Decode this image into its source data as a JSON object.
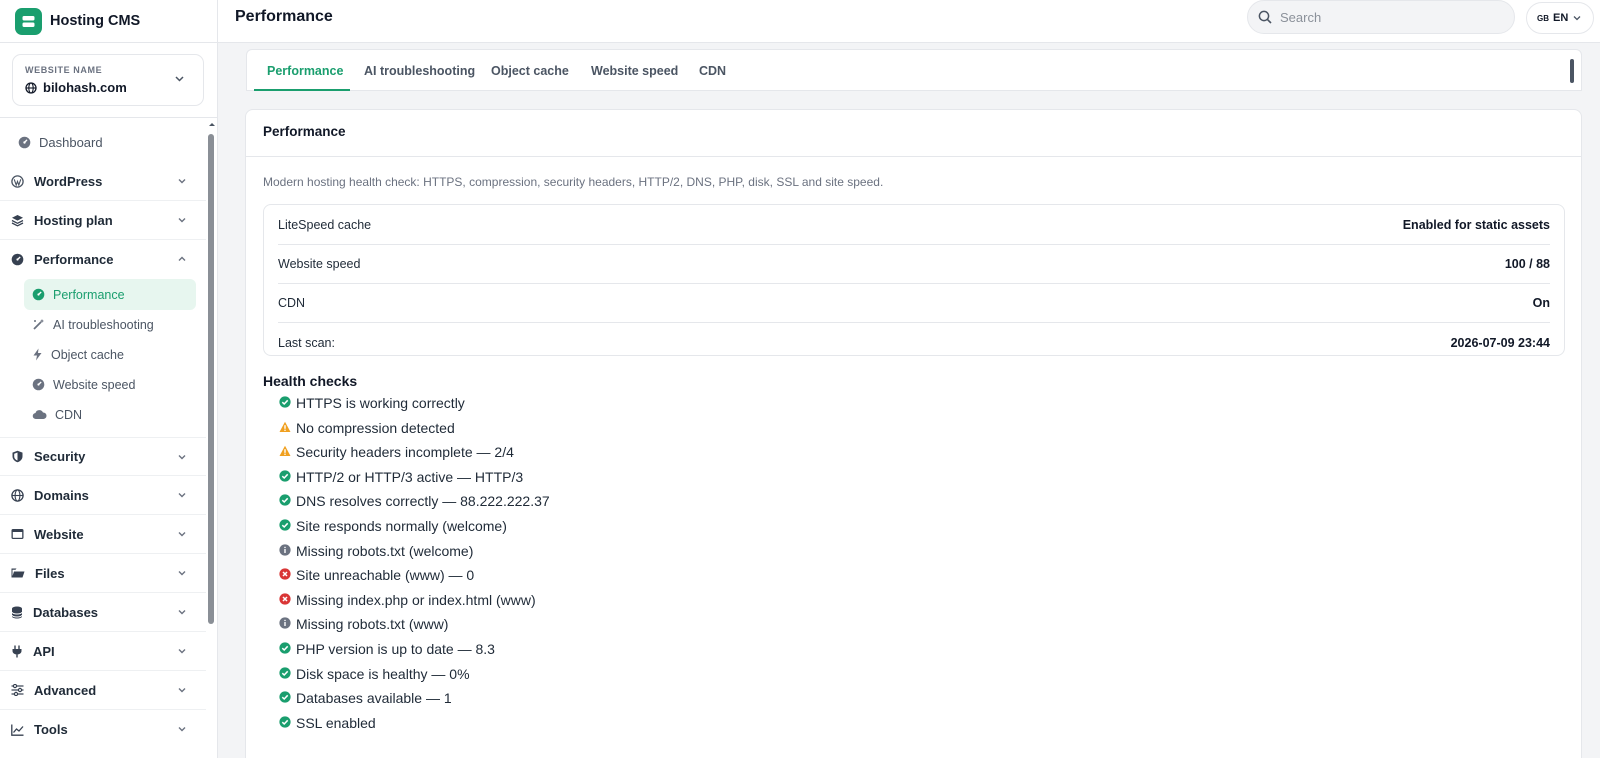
{
  "app": {
    "title": "Hosting CMS"
  },
  "website": {
    "caption": "WEBSITE NAME",
    "value": "bilohash.com"
  },
  "sidebar": {
    "dashboard": "Dashboard",
    "items": [
      {
        "label": "WordPress",
        "icon": "wordpress-icon"
      },
      {
        "label": "Hosting plan",
        "icon": "layers-icon"
      },
      {
        "label": "Performance",
        "icon": "speed-icon",
        "expanded": true
      },
      {
        "label": "Security",
        "icon": "shield-icon"
      },
      {
        "label": "Domains",
        "icon": "globe-icon"
      },
      {
        "label": "Website",
        "icon": "browser-icon"
      },
      {
        "label": "Files",
        "icon": "folder-icon"
      },
      {
        "label": "Databases",
        "icon": "database-icon"
      },
      {
        "label": "API",
        "icon": "plug-icon"
      },
      {
        "label": "Advanced",
        "icon": "sliders-icon"
      },
      {
        "label": "Tools",
        "icon": "chart-icon"
      }
    ],
    "performance_sub": [
      {
        "label": "Performance",
        "icon": "speed-icon",
        "active": true
      },
      {
        "label": "AI troubleshooting",
        "icon": "magic-wand-icon"
      },
      {
        "label": "Object cache",
        "icon": "bolt-icon"
      },
      {
        "label": "Website speed",
        "icon": "gauge-icon"
      },
      {
        "label": "CDN",
        "icon": "cloud-icon"
      }
    ]
  },
  "header": {
    "title": "Performance",
    "search_placeholder": "Search",
    "lang_flag": "GB",
    "lang_code": "EN"
  },
  "tabs": [
    "Performance",
    "AI troubleshooting",
    "Object cache",
    "Website speed",
    "CDN"
  ],
  "card": {
    "title": "Performance",
    "description": "Modern hosting health check: HTTPS, compression, security headers, HTTP/2, DNS, PHP, disk, SSL and site speed.",
    "rows": [
      {
        "key": "LiteSpeed cache",
        "value": "Enabled for static assets"
      },
      {
        "key": "Website speed",
        "value": "100 / 88"
      },
      {
        "key": "CDN",
        "value": "On"
      },
      {
        "key": "Last scan:",
        "value": "2026-07-09 23:44"
      }
    ]
  },
  "health": {
    "title": "Health checks",
    "items": [
      {
        "status": "ok",
        "text": "HTTPS is working correctly"
      },
      {
        "status": "warn",
        "text": "No compression detected"
      },
      {
        "status": "warn",
        "text": "Security headers incomplete — 2/4"
      },
      {
        "status": "ok",
        "text": "HTTP/2 or HTTP/3 active — HTTP/3"
      },
      {
        "status": "ok",
        "text": "DNS resolves correctly — 88.222.222.37"
      },
      {
        "status": "ok",
        "text": "Site responds normally (welcome)"
      },
      {
        "status": "info",
        "text": "Missing robots.txt (welcome)"
      },
      {
        "status": "error",
        "text": "Site unreachable (www) — 0"
      },
      {
        "status": "error",
        "text": "Missing index.php or index.html (www)"
      },
      {
        "status": "info",
        "text": "Missing robots.txt (www)"
      },
      {
        "status": "ok",
        "text": "PHP version is up to date — 8.3"
      },
      {
        "status": "ok",
        "text": "Disk space is healthy — 0%"
      },
      {
        "status": "ok",
        "text": "Databases available — 1"
      },
      {
        "status": "ok",
        "text": "SSL enabled"
      }
    ]
  },
  "colors": {
    "accent": "#1a9e6e",
    "ok": "#1a9e6e",
    "warn": "#f0a020",
    "error": "#d93636",
    "info": "#6b7280"
  }
}
